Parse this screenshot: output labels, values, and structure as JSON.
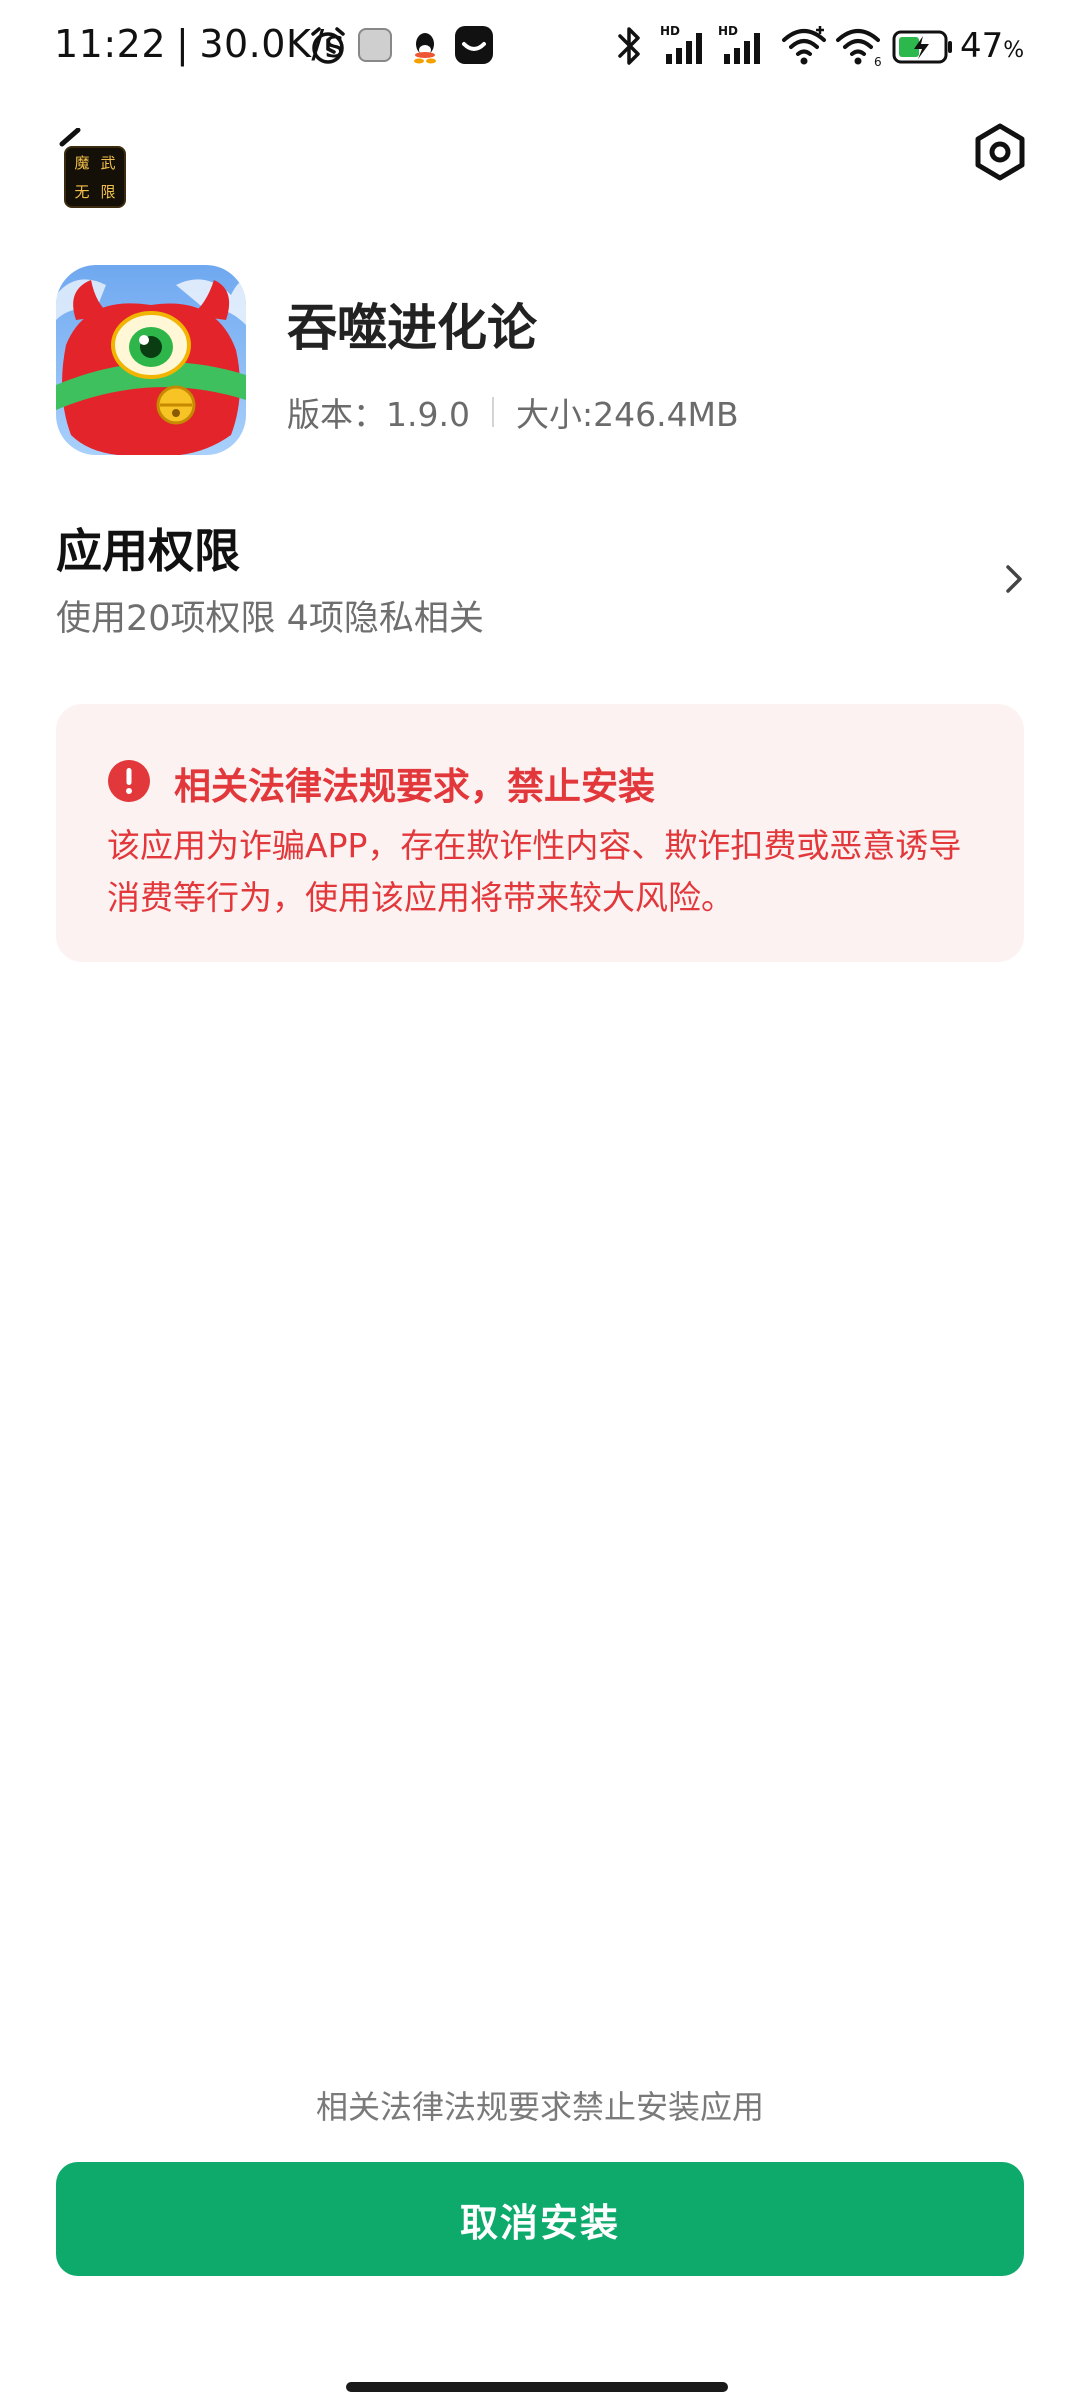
{
  "status_bar": {
    "time": "11:22",
    "net_speed": "30.0K/s",
    "battery_percent": "47",
    "battery_unit": "%",
    "battery_level": 0.47,
    "icons": [
      "alarm-icon",
      "notification-icon",
      "qq-icon",
      "app-icon",
      "bluetooth-icon",
      "hd-signal-icon",
      "hd-signal-icon",
      "wifi-icon",
      "wifi-icon",
      "battery-charging-icon"
    ]
  },
  "header": {
    "back_icon": "back-arrow-icon",
    "source_app_thumb_chars": [
      "魔",
      "武",
      "无",
      "限"
    ],
    "settings_icon": "settings-icon"
  },
  "app": {
    "name": "吞噬进化论",
    "version_label": "版本：1.9.0",
    "size_label": "大小:246.4MB"
  },
  "permissions": {
    "title": "应用权限",
    "subtitle": "使用20项权限 4项隐私相关"
  },
  "warning": {
    "title": "相关法律法规要求，禁止安装",
    "body": "该应用为诈骗APP，存在欺诈性内容、欺诈扣费或恶意诱导消费等行为，使用该应用将带来较大风险。",
    "color": "#e2383b"
  },
  "footer": {
    "note": "相关法律法规要求禁止安装应用",
    "cancel_button": "取消安装",
    "button_color": "#0daa6c"
  }
}
